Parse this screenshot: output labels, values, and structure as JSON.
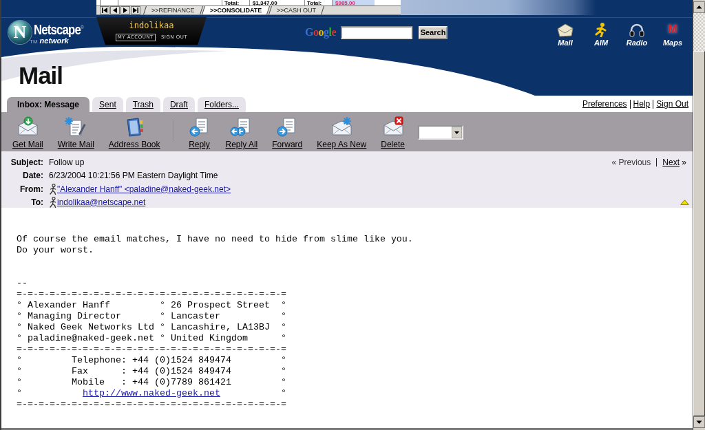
{
  "ad_banner": {
    "totals": [
      {
        "label": "Total:",
        "amount": "$1,347.00"
      },
      {
        "label": "Total:",
        "amount": "$985.00"
      }
    ],
    "tabs": [
      {
        "label": ">>REFINANCE",
        "selected": false
      },
      {
        "label": ">>CONSOLIDATE",
        "selected": true
      },
      {
        "label": ">>CASH OUT",
        "selected": false
      }
    ]
  },
  "site_header": {
    "logo": {
      "letter": "N",
      "name": "Netscape$^{®}$",
      "trademark": "TM",
      "tagline": "network"
    },
    "account": {
      "username": "indolikaa",
      "links": [
        "MY ACCOUNT",
        "SIGN OUT"
      ]
    },
    "search": {
      "logo": "Google",
      "button": "Search"
    },
    "services": [
      {
        "label": "Mail"
      },
      {
        "label": "AIM"
      },
      {
        "label": "Radio"
      },
      {
        "label": "Maps",
        "glyph": "M"
      }
    ]
  },
  "page_title": "Mail",
  "tabs": [
    {
      "label": "Inbox: Message",
      "selected": true
    },
    {
      "label": "Sent",
      "selected": false
    },
    {
      "label": "Trash",
      "selected": false
    },
    {
      "label": "Draft",
      "selected": false
    },
    {
      "label": "Folders...",
      "selected": false
    }
  ],
  "top_links": [
    "Preferences",
    "Help",
    "Sign Out"
  ],
  "toolbar": {
    "mail_buttons": [
      "Get Mail",
      "Write Mail",
      "Address Book"
    ],
    "message_buttons": [
      "Reply",
      "Reply All",
      "Forward",
      "Keep As New",
      "Delete"
    ]
  },
  "message": {
    "fields": [
      {
        "kind": "text",
        "label": "Subject:",
        "value": "Follow up"
      },
      {
        "kind": "text",
        "label": "Date:",
        "value": "6/23/2004 10:21:56 PM Eastern Daylight Time"
      },
      {
        "kind": "contact",
        "label": "From:",
        "value": "\"Alexander Hanff\" <paladine@naked-geek.net>"
      },
      {
        "kind": "contact",
        "label": "To:",
        "value": "indolikaa@netscape.net"
      }
    ],
    "navigation": [
      {
        "arrow": "«",
        "label": "Previous",
        "disabled": true
      },
      {
        "arrow": "»",
        "label": "Next",
        "disabled": false
      }
    ]
  },
  "body": {
    "text": [
      "Of course the email matches, I have no need to hide from slime like you.",
      "Do your worst."
    ],
    "signature": [
      {
        "kind": "text",
        "text": "--"
      },
      {
        "kind": "text",
        "text": "=-=-=-=-=-=-=-=-=-=-=-=-=-=-=-=-=-=-=-=-=-=-=-=-="
      },
      {
        "kind": "text",
        "text": "° Alexander Hanff         ° 26 Prospect Street  °"
      },
      {
        "kind": "text",
        "text": "° Managing Director       ° Lancaster           °"
      },
      {
        "kind": "text",
        "text": "° Naked Geek Networks Ltd ° Lancashire, LA13BJ  °"
      },
      {
        "kind": "text",
        "text": "° paladine@naked-geek.net ° United Kingdom      °"
      },
      {
        "kind": "text",
        "text": "=-=-=-=-=-=-=-=-=-=-=-=-=-=-=-=-=-=-=-=-=-=-=-=-="
      },
      {
        "kind": "text",
        "text": "°         Telephone: +44 (0)1524 849474         °"
      },
      {
        "kind": "text",
        "text": "°         Fax      : +44 (0)1524 849474         °"
      },
      {
        "kind": "text",
        "text": "°         Mobile   : +44 (0)7789 861421         °"
      },
      {
        "kind": "link",
        "before": "°           ",
        "link": "http://www.naked-geek.net",
        "after": "           °"
      },
      {
        "kind": "text",
        "text": "=-=-=-=-=-=-=-=-=-=-=-=-=-=-=-=-=-=-=-=-=-=-=-=-="
      }
    ]
  }
}
